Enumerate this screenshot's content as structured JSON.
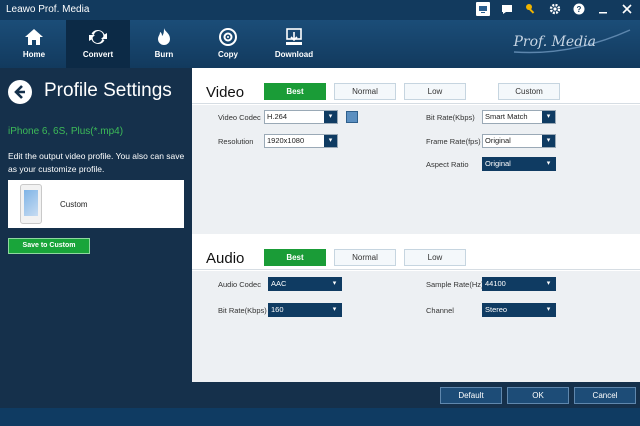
{
  "window": {
    "title": "Leawo Prof. Media"
  },
  "toolbar": {
    "items": [
      {
        "label": "Home",
        "icon": "home-icon"
      },
      {
        "label": "Convert",
        "icon": "convert-icon"
      },
      {
        "label": "Burn",
        "icon": "burn-icon"
      },
      {
        "label": "Copy",
        "icon": "copy-icon"
      },
      {
        "label": "Download",
        "icon": "download-icon"
      }
    ],
    "active": "Convert",
    "brand": "Prof. Media"
  },
  "left": {
    "title": "Profile Settings",
    "device": "iPhone 6, 6S, Plus(*.mp4)",
    "description": "Edit the output video profile. You also can save as your customize profile.",
    "custom_label": "Custom",
    "save_button": "Save to Custom"
  },
  "video": {
    "title": "Video",
    "qualities": [
      "Best",
      "Normal",
      "Low",
      "Custom"
    ],
    "selected": "Best",
    "codec_label": "Video Codec",
    "codec": "H.264",
    "resolution_label": "Resolution",
    "resolution": "1920x1080",
    "bitrate_label": "Bit Rate(Kbps)",
    "bitrate": "Smart Match",
    "framerate_label": "Frame Rate(fps)",
    "framerate": "Original",
    "aspect_label": "Aspect Ratio",
    "aspect": "Original"
  },
  "audio": {
    "title": "Audio",
    "qualities": [
      "Best",
      "Normal",
      "Low"
    ],
    "selected": "Best",
    "codec_label": "Audio Codec",
    "codec": "AAC",
    "bitrate_label": "Bit Rate(Kbps)",
    "bitrate": "160",
    "samplerate_label": "Sample Rate(Hz)",
    "samplerate": "44100",
    "channel_label": "Channel",
    "channel": "Stereo"
  },
  "footer": {
    "default": "Default",
    "ok": "OK",
    "cancel": "Cancel"
  },
  "colors": {
    "accent_green": "#1a9c37",
    "dark_blue": "#0f3b62",
    "panel": "#15304b"
  }
}
